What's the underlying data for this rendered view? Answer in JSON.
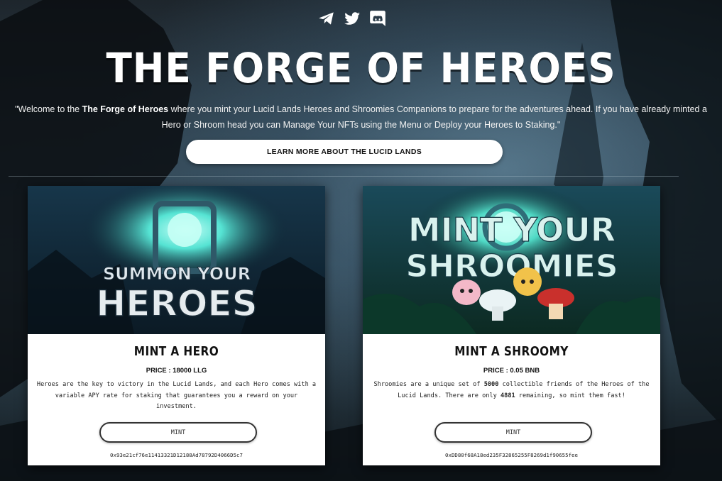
{
  "social": {
    "icons": [
      "telegram-icon",
      "twitter-icon",
      "discord-icon"
    ]
  },
  "header": {
    "title": "THE FORGE OF HEROES",
    "intro_prefix": "\"Welcome to the ",
    "intro_bold": "The Forge of Heroes",
    "intro_suffix": " where you mint your Lucid Lands Heroes and Shroomies Companions to prepare for the adventures ahead. If you have already minted a Hero or Shroom head you can Manage Your NFTs using the Menu or Deploy your Heroes to Staking.\"",
    "learn_more_label": "LEARN MORE ABOUT THE LUCID LANDS"
  },
  "cards": [
    {
      "art_line1": "SUMMON YOUR",
      "art_line2": "HEROES",
      "title": "MINT A HERO",
      "price": "PRICE : 18000 LLG",
      "description": "Heroes are the key to victory in the Lucid Lands, and each Hero comes with a variable APY rate for staking that guarantees you a reward on your investment.",
      "mint_label": "MINT",
      "address": "0x93e21cf76e11413321D12188Ad78792D4066D5c7"
    },
    {
      "art_line1": "MINT YOUR",
      "art_line2": "SHROOMIES",
      "title": "MINT A SHROOMY",
      "price": "PRICE : 0.05 BNB",
      "desc_prefix": "Shroomies are a unique set of ",
      "desc_bold1": "5000",
      "desc_middle": " collectible friends of the Heroes of the Lucid Lands. There are only ",
      "desc_bold2": "4881",
      "desc_suffix": " remaining, so mint them fast!",
      "mint_label": "MINT",
      "address": "0xDD80f68A18ed235F32865255F8269d1f90655fee"
    }
  ],
  "colors": {
    "card_bg": "#ffffff",
    "glow": "#7ff5e8",
    "accent_cyan": "#5fd8d0"
  }
}
